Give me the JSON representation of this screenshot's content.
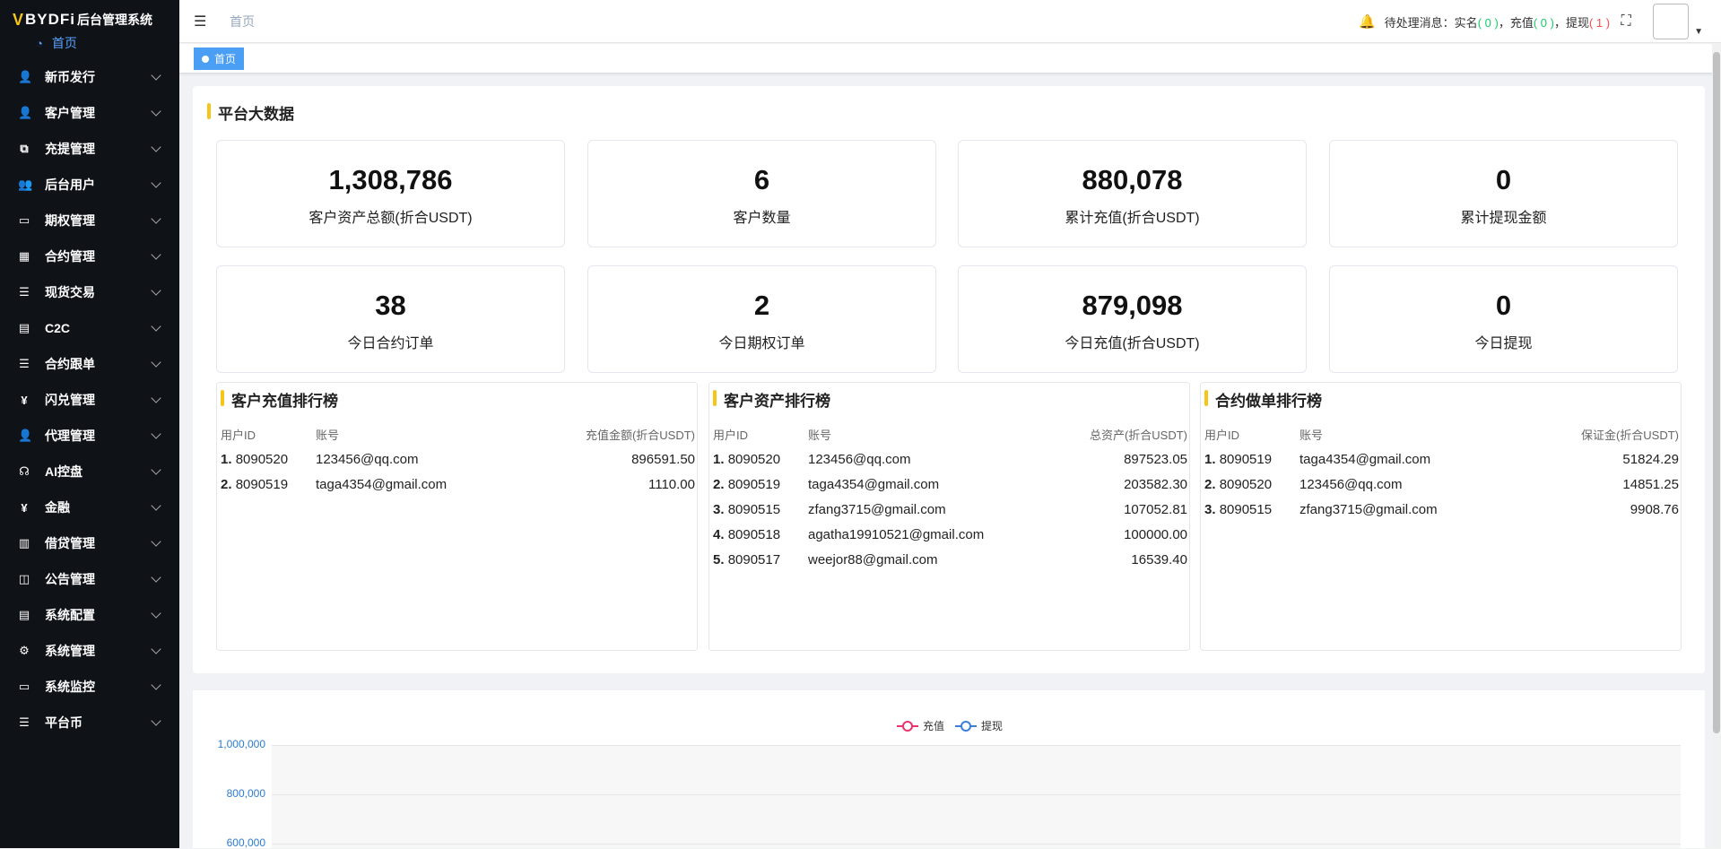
{
  "app": {
    "logo_mark": "V",
    "logo_text": "BYDFi",
    "logo_sub": "后台管理系统",
    "accent_color": "#f5c518"
  },
  "sidebar": {
    "home_label": "首页",
    "items": [
      {
        "label": "新币发行",
        "icon": "user-icon"
      },
      {
        "label": "客户管理",
        "icon": "user-icon"
      },
      {
        "label": "充提管理",
        "icon": "copy-icon"
      },
      {
        "label": "后台用户",
        "icon": "users-icon"
      },
      {
        "label": "期权管理",
        "icon": "monitor-icon"
      },
      {
        "label": "合约管理",
        "icon": "grid-icon"
      },
      {
        "label": "现货交易",
        "icon": "list-icon"
      },
      {
        "label": "C2C",
        "icon": "document-icon"
      },
      {
        "label": "合约跟单",
        "icon": "list-icon"
      },
      {
        "label": "闪兑管理",
        "icon": "yen-icon"
      },
      {
        "label": "代理管理",
        "icon": "user-icon"
      },
      {
        "label": "AI控盘",
        "icon": "robot-icon"
      },
      {
        "label": "金融",
        "icon": "yen-icon"
      },
      {
        "label": "借贷管理",
        "icon": "book-icon"
      },
      {
        "label": "公告管理",
        "icon": "open-book-icon"
      },
      {
        "label": "系统配置",
        "icon": "document-icon"
      },
      {
        "label": "系统管理",
        "icon": "gear-icon"
      },
      {
        "label": "系统监控",
        "icon": "monitor-icon"
      },
      {
        "label": "平台币",
        "icon": "list-icon"
      }
    ]
  },
  "header": {
    "breadcrumb": "首页",
    "notice_prefix": "待处理消息：实名",
    "realname_count": "( 0 )",
    "sep1": "，充值",
    "deposit_count": "( 0 )",
    "sep2": "，提现",
    "withdraw_count": "( 1 )"
  },
  "tags": {
    "active": "首页"
  },
  "overview": {
    "title": "平台大数据",
    "stats": [
      {
        "value": "1,308,786",
        "label": "客户资产总额(折合USDT)"
      },
      {
        "value": "6",
        "label": "客户数量"
      },
      {
        "value": "880,078",
        "label": "累计充值(折合USDT)"
      },
      {
        "value": "0",
        "label": "累计提现金额"
      },
      {
        "value": "38",
        "label": "今日合约订单"
      },
      {
        "value": "2",
        "label": "今日期权订单"
      },
      {
        "value": "879,098",
        "label": "今日充值(折合USDT)"
      },
      {
        "value": "0",
        "label": "今日提现"
      }
    ]
  },
  "rankings": [
    {
      "title": "客户充值排行榜",
      "headers": [
        "用户ID",
        "账号",
        "充值金额(折合USDT)"
      ],
      "rows": [
        {
          "rank": "1.",
          "id": "8090520",
          "account": "123456@qq.com",
          "amount": "896591.50"
        },
        {
          "rank": "2.",
          "id": "8090519",
          "account": "taga4354@gmail.com",
          "amount": "1110.00"
        }
      ]
    },
    {
      "title": "客户资产排行榜",
      "headers": [
        "用户ID",
        "账号",
        "总资产(折合USDT)"
      ],
      "rows": [
        {
          "rank": "1.",
          "id": "8090520",
          "account": "123456@qq.com",
          "amount": "897523.05"
        },
        {
          "rank": "2.",
          "id": "8090519",
          "account": "taga4354@gmail.com",
          "amount": "203582.30"
        },
        {
          "rank": "3.",
          "id": "8090515",
          "account": "zfang3715@gmail.com",
          "amount": "107052.81"
        },
        {
          "rank": "4.",
          "id": "8090518",
          "account": "agatha19910521@gmail.com",
          "amount": "100000.00"
        },
        {
          "rank": "5.",
          "id": "8090517",
          "account": "weejor88@gmail.com",
          "amount": "16539.40"
        }
      ]
    },
    {
      "title": "合约做单排行榜",
      "headers": [
        "用户ID",
        "账号",
        "保证金(折合USDT)"
      ],
      "rows": [
        {
          "rank": "1.",
          "id": "8090519",
          "account": "taga4354@gmail.com",
          "amount": "51824.29"
        },
        {
          "rank": "2.",
          "id": "8090520",
          "account": "123456@qq.com",
          "amount": "14851.25"
        },
        {
          "rank": "3.",
          "id": "8090515",
          "account": "zfang3715@gmail.com",
          "amount": "9908.76"
        }
      ]
    }
  ],
  "chart_data": {
    "type": "line",
    "series": [
      {
        "name": "充值",
        "color": "#e8336d",
        "values": []
      },
      {
        "name": "提现",
        "color": "#3b7ddd",
        "values": []
      }
    ],
    "y_tick_labels": [
      "1,000,000",
      "800,000",
      "600,000"
    ],
    "legend_position": "top-center",
    "grid": true
  }
}
